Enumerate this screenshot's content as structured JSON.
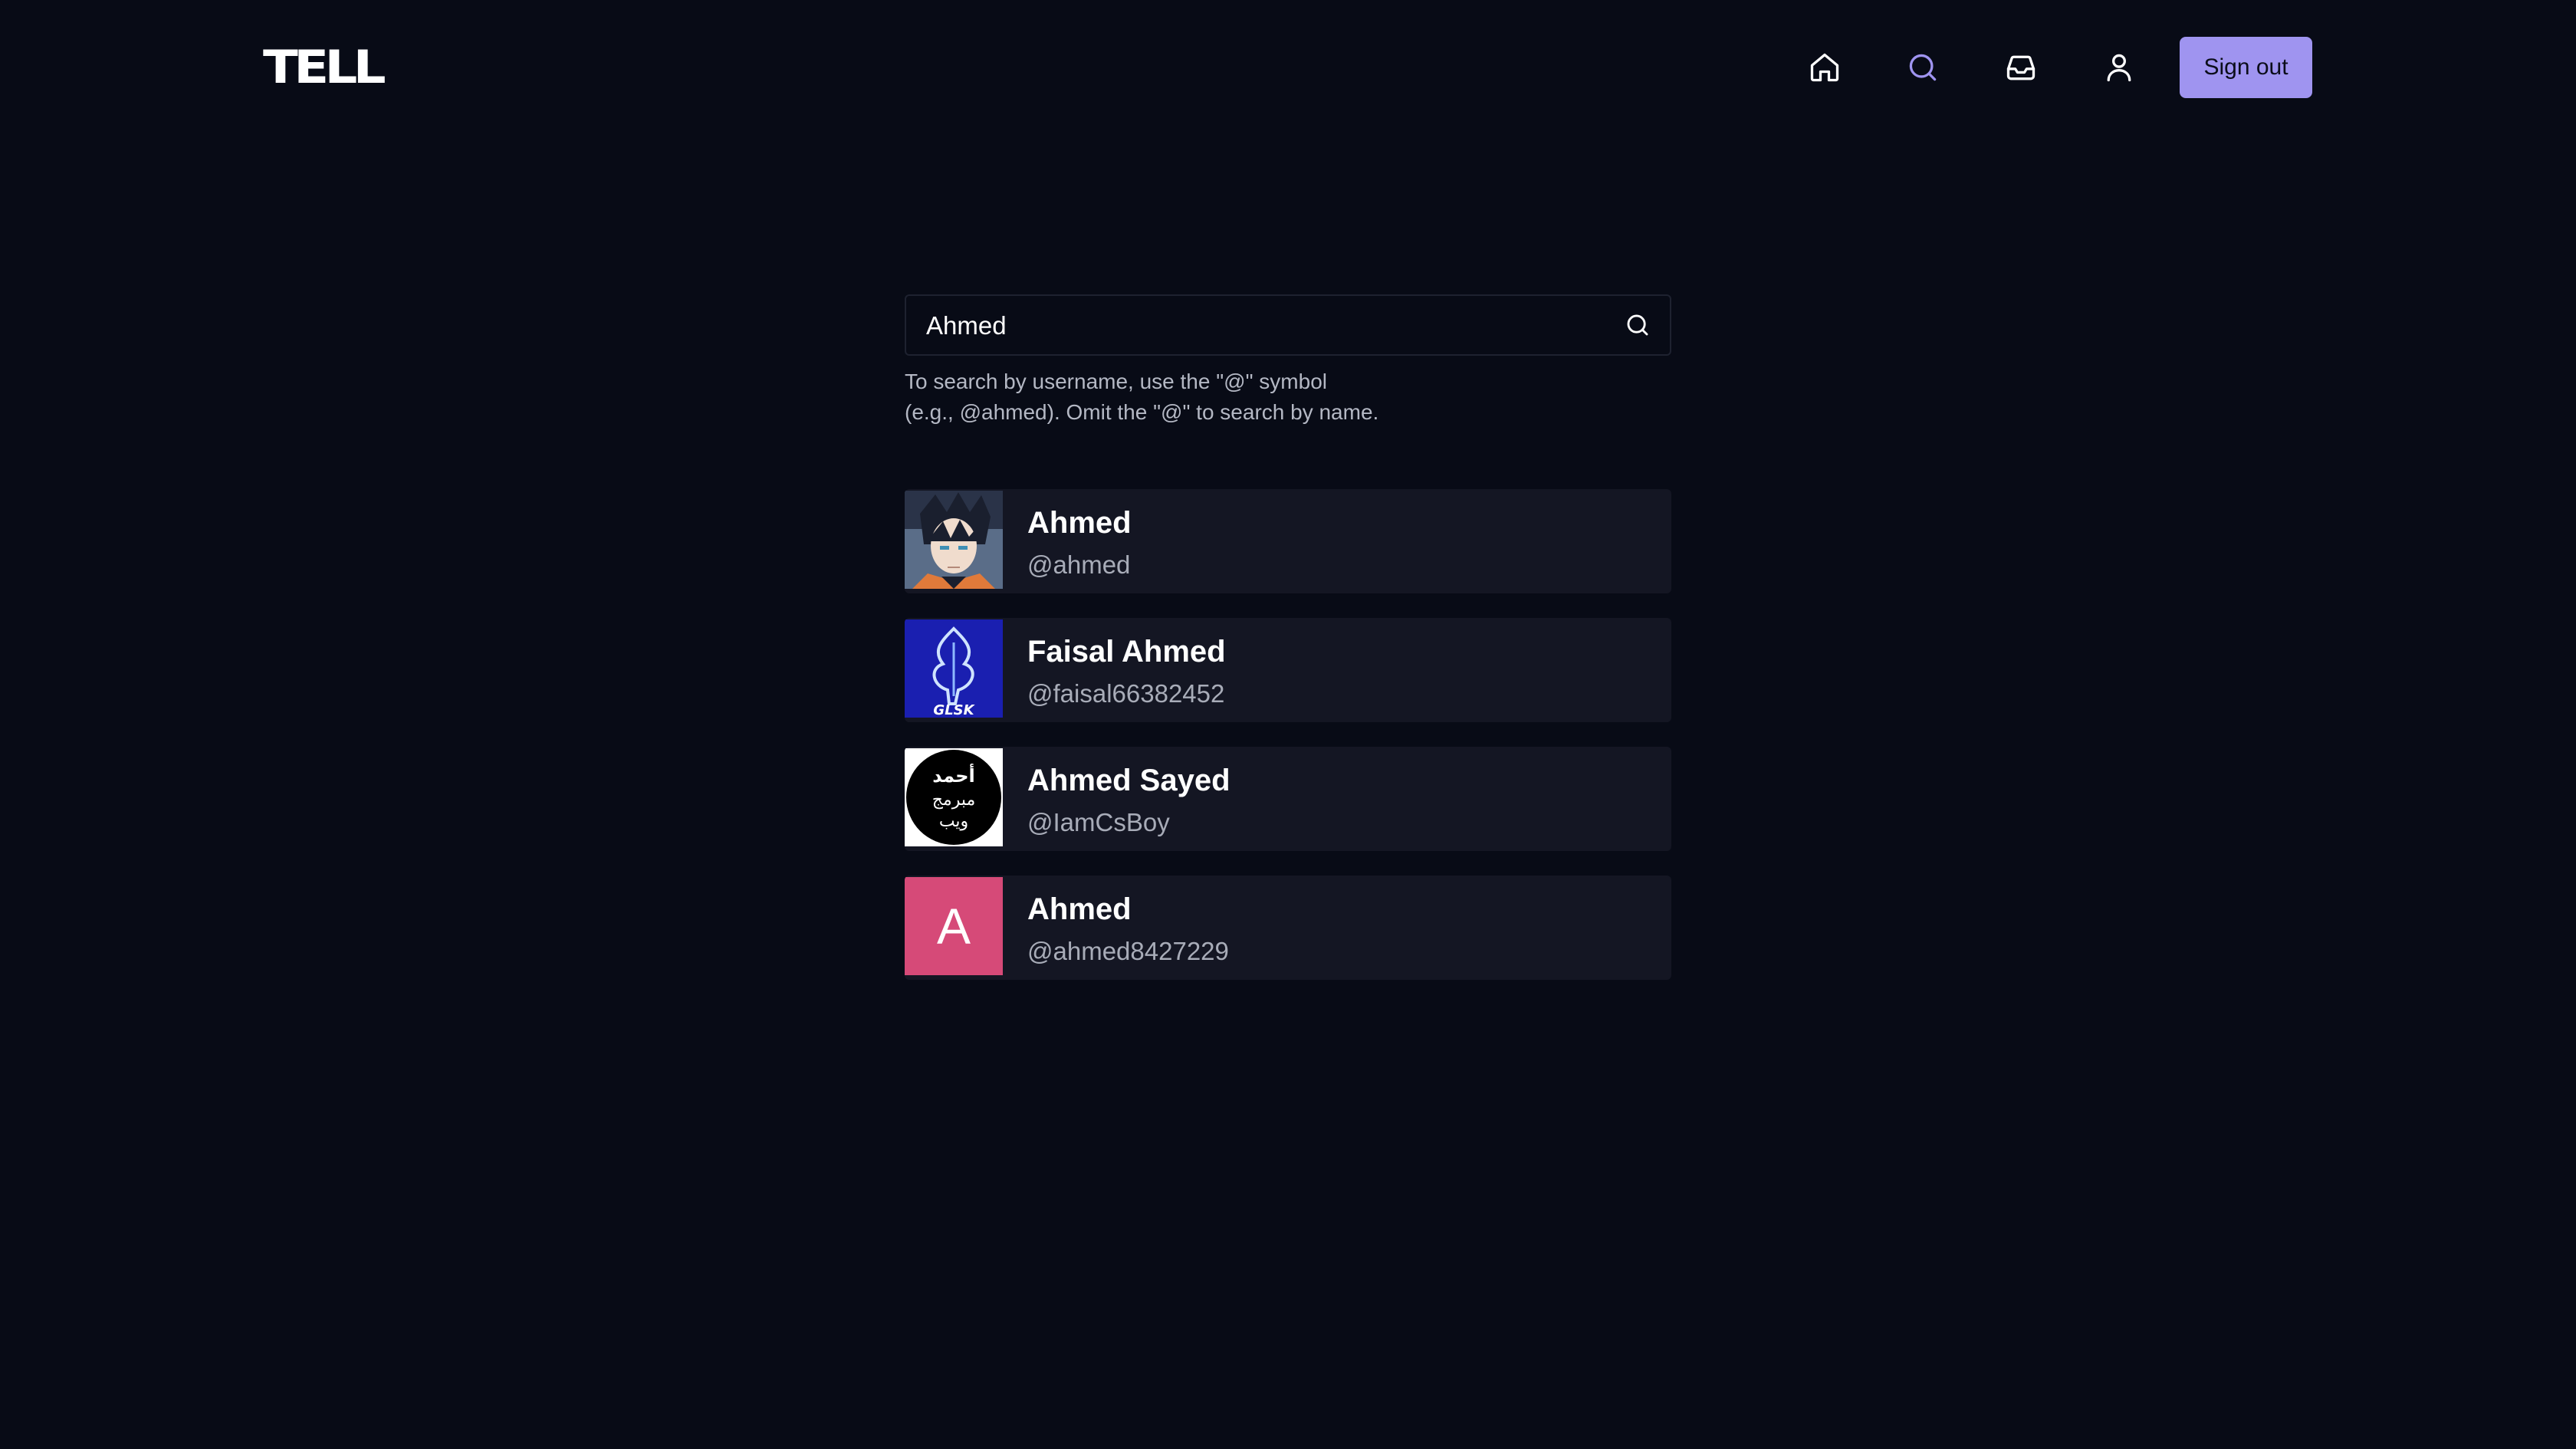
{
  "header": {
    "logo": "TELL",
    "nav": [
      {
        "icon": "home-icon",
        "active": false
      },
      {
        "icon": "search-icon",
        "active": true
      },
      {
        "icon": "inbox-icon",
        "active": false
      },
      {
        "icon": "user-icon",
        "active": false
      }
    ],
    "sign_out_label": "Sign out"
  },
  "search": {
    "value": "Ahmed",
    "placeholder": "",
    "hint_line1": "To search by username, use the \"@\" symbol",
    "hint_line2": "(e.g., @ahmed). Omit the \"@\" to search by name."
  },
  "results": [
    {
      "name": "Ahmed",
      "handle": "@ahmed",
      "avatar": "anime-avatar"
    },
    {
      "name": "Faisal Ahmed",
      "handle": "@faisal66382452",
      "avatar": "blue-logo-avatar",
      "avatar_text": "GLSK"
    },
    {
      "name": "Ahmed Sayed",
      "handle": "@IamCsBoy",
      "avatar": "arabic-logo-avatar",
      "avatar_text": "أحمد مبرمج ويب"
    },
    {
      "name": "Ahmed",
      "handle": "@ahmed8427229",
      "avatar": "letter-avatar",
      "avatar_letter": "A"
    }
  ],
  "colors": {
    "background": "#080b16",
    "accent": "#9f94f0",
    "card": "#141623",
    "letter_avatar": "#d64a78"
  }
}
